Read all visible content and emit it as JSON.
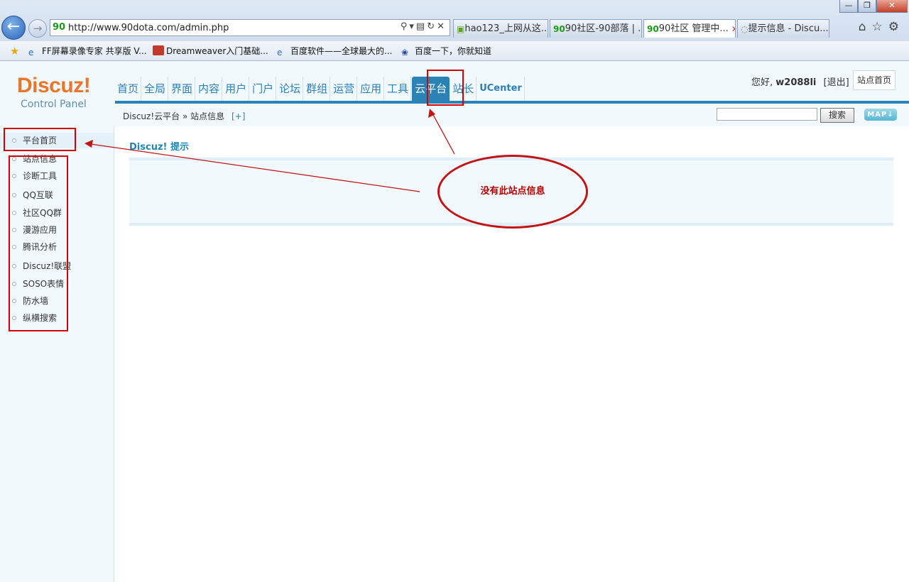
{
  "browser": {
    "url": "http://www.90dota.com/admin.php",
    "tabs": [
      {
        "icon": "hao",
        "label": "hao123_上网从这...",
        "active": false
      },
      {
        "icon": "90",
        "label": "90社区-90部落 | ...",
        "active": false
      },
      {
        "icon": "90",
        "label": "90社区 管理中...",
        "active": true
      },
      {
        "icon": "loading",
        "label": "提示信息 - Discu...",
        "active": false
      }
    ],
    "favorites": [
      "FF屏幕录像专家 共享版 V...",
      "Dreamweaver入门基础...",
      "百度软件——全球最大的...",
      "百度一下，你就知道"
    ]
  },
  "header": {
    "logo": "Discuz!",
    "logo_sub": "Control Panel",
    "nav": [
      "首页",
      "全局",
      "界面",
      "内容",
      "用户",
      "门户",
      "论坛",
      "群组",
      "运营",
      "应用",
      "工具",
      "云平台",
      "站长",
      "UCenter"
    ],
    "active_nav": "云平台",
    "greeting": "您好,",
    "username": "w2088li",
    "logout": "[退出]",
    "site_home": "站点首页",
    "breadcrumb": "Discuz!云平台 » 站点信息",
    "breadcrumb_add": "[+]",
    "search_button": "搜索",
    "map_button": "MAP"
  },
  "sidebar": {
    "items": [
      "平台首页",
      "站点信息",
      "诊断工具",
      "QQ互联",
      "社区QQ群",
      "漫游应用",
      "腾讯分析",
      "Discuz!联盟",
      "SOSO表情",
      "防水墙",
      "纵横搜索"
    ],
    "active": "平台首页"
  },
  "main": {
    "title": "Discuz! 提示",
    "message": ""
  },
  "annotation": {
    "text": "没有此站点信息",
    "color": "#c21414"
  }
}
